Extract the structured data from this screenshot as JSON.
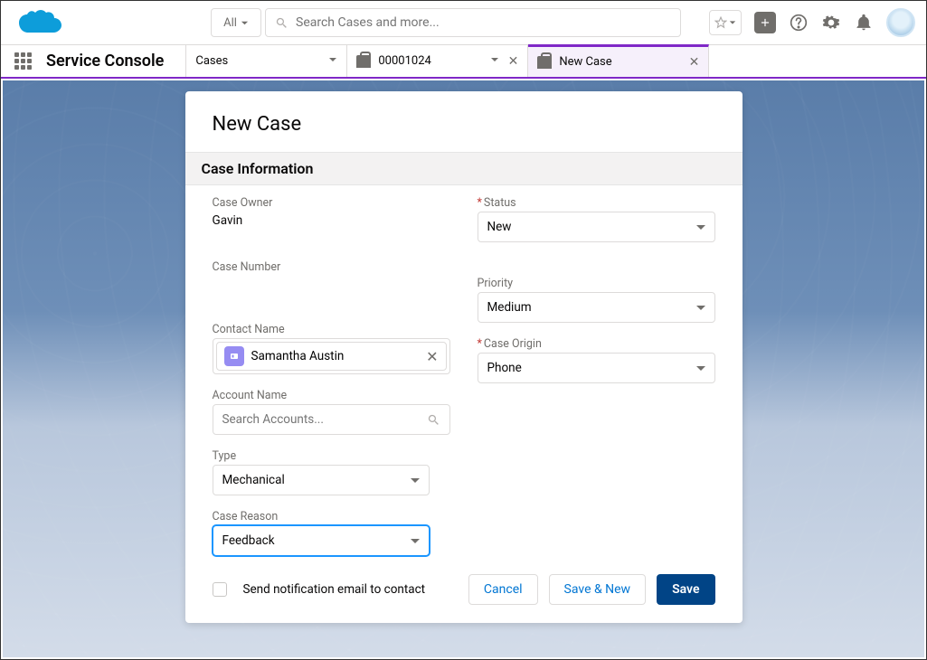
{
  "header": {
    "search_scope": "All",
    "search_placeholder": "Search Cases and more..."
  },
  "app": {
    "name": "Service Console"
  },
  "tabs": {
    "root": "Cases",
    "record": "00001024",
    "new": "New Case"
  },
  "card": {
    "title": "New Case",
    "section": "Case Information"
  },
  "fields": {
    "case_owner_label": "Case Owner",
    "case_owner_value": "Gavin",
    "case_number_label": "Case Number",
    "contact_name_label": "Contact Name",
    "contact_name_value": "Samantha Austin",
    "account_name_label": "Account Name",
    "account_placeholder": "Search Accounts...",
    "type_label": "Type",
    "type_value": "Mechanical",
    "case_reason_label": "Case Reason",
    "case_reason_value": "Feedback",
    "status_label": "Status",
    "status_value": "New",
    "priority_label": "Priority",
    "priority_value": "Medium",
    "case_origin_label": "Case Origin",
    "case_origin_value": "Phone"
  },
  "footer": {
    "notify_label": "Send notification email to contact",
    "cancel": "Cancel",
    "save_new": "Save & New",
    "save": "Save"
  }
}
